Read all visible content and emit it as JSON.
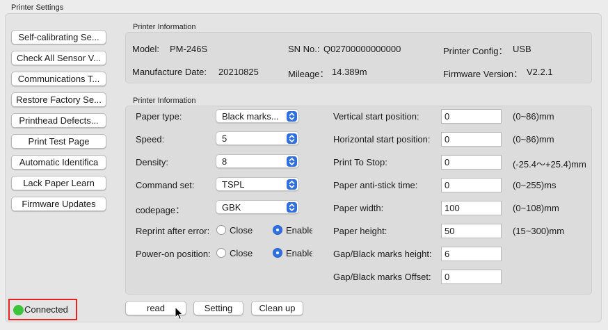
{
  "window": {
    "title": "Printer Settings"
  },
  "sidebar": {
    "buttons": [
      "Self-calibrating Se...",
      "Check All Sensor V...",
      "Communications T...",
      "Restore Factory Se...",
      "Printhead Defects...",
      "Print Test Page",
      "Automatic Identifica",
      "Lack Paper Learn",
      "Firmware Updates"
    ]
  },
  "info": {
    "group_label": "Printer Information",
    "model_label": "Model:",
    "model_value": "PM-246S",
    "sn_label": "SN No.:",
    "sn_value": "Q02700000000000",
    "config_label": "Printer Config：",
    "config_value": "USB",
    "mfg_label": "Manufacture Date:",
    "mfg_value": "20210825",
    "mileage_label": "Mileage：",
    "mileage_value": "14.389m",
    "fw_label": "Firmware Version：",
    "fw_value": "V2.2.1"
  },
  "settings": {
    "group_label": "Printer Information",
    "paper_type_label": "Paper type:",
    "paper_type_value": "Black marks...",
    "speed_label": "Speed:",
    "speed_value": "5",
    "density_label": "Density:",
    "density_value": "8",
    "command_set_label": "Command set:",
    "command_set_value": "TSPL",
    "codepage_label": "codepage：",
    "codepage_value": "GBK",
    "reprint_label": "Reprint after error:",
    "reprint_close": "Close",
    "reprint_enable": "Enable",
    "poweron_label": "Power-on position:",
    "poweron_close": "Close",
    "poweron_enable": "Enable",
    "vstart_label": "Vertical start position:",
    "vstart_value": "0",
    "vstart_range": "(0~86)mm",
    "hstart_label": "Horizontal start position:",
    "hstart_value": "0",
    "hstart_range": "(0~86)mm",
    "pstop_label": "Print To Stop:",
    "pstop_value": "0",
    "pstop_range": "(-25.4～+25.4)mm",
    "antistick_label": "Paper anti-stick time:",
    "antistick_value": "0",
    "antistick_range": "(0~255)ms",
    "pwidth_label": "Paper width:",
    "pwidth_value": "100",
    "pwidth_range": "(0~108)mm",
    "pheight_label": "Paper height:",
    "pheight_value": "50",
    "pheight_range": "(15~300)mm",
    "gapheight_label": "Gap/Black marks height:",
    "gapheight_value": "6",
    "gapoffset_label": "Gap/Black marks Offset:",
    "gapoffset_value": "0"
  },
  "footer": {
    "read_label": "read",
    "setting_label": "Setting",
    "cleanup_label": "Clean up"
  },
  "status": {
    "text": "Connected",
    "dot_color": "#3cc43c",
    "border_color": "#e02424"
  },
  "accent_color": "#2f6fe0"
}
